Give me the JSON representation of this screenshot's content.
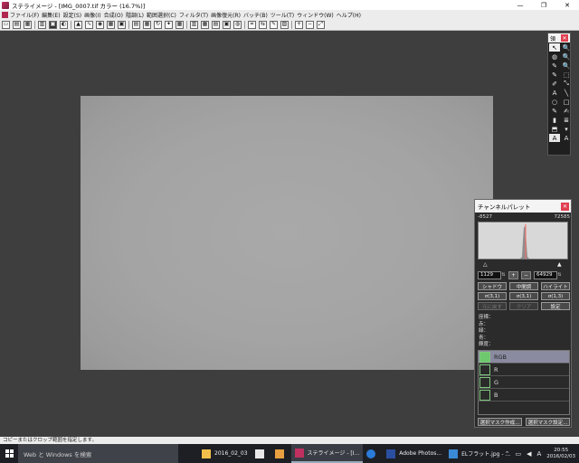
{
  "window": {
    "title": "ステライメージ - [IMG_0007.tif カラー (16.7%)]",
    "controls": [
      "—",
      "❐",
      "✕"
    ]
  },
  "menubar": {
    "items": [
      "ファイル(F)",
      "編集(E)",
      "設定(S)",
      "画像(I)",
      "合成(O)",
      "階調(L)",
      "範囲選択(C)",
      "フィルタ(T)",
      "画像復元(R)",
      "バッチ(B)",
      "ツール(T)",
      "ウィンドウ(W)",
      "ヘルプ(H)"
    ]
  },
  "tool_palette": {
    "title": "領",
    "close": "✕",
    "tools": [
      "↖",
      "🔍",
      "◍",
      "🔍",
      "✎",
      "🔍",
      "✎",
      "⬚",
      "✐",
      "⤡",
      "A",
      "╲",
      "○",
      "□",
      "✎",
      "✍",
      "▮",
      "≣",
      "⬒",
      "▾",
      "A",
      "A"
    ]
  },
  "channel_palette": {
    "title": "チャンネルパレット",
    "close": "✕",
    "range_min": "-8527",
    "range_max": "72585",
    "value_low": "1129",
    "value_high": "64929",
    "buttons": [
      "シャドウ",
      "中間調",
      "ハイライト",
      "σ(3,1)",
      "σ(3,1)",
      "σ(1,3)",
      "元に戻す",
      "クリア",
      "設定"
    ],
    "info_labels": [
      "座標：",
      "赤：",
      "緑：",
      "青：",
      "輝度："
    ],
    "channels": [
      "RGB",
      "R",
      "G",
      "B"
    ],
    "mask_buttons": [
      "選択マスク作成...",
      "選択マスク設定..."
    ]
  },
  "statusbar": {
    "text": "コピーまたはクロップ範囲を指定します。"
  },
  "taskbar": {
    "search_placeholder": "Web と Windows を検索",
    "apps": [
      {
        "label": "2016_02_03",
        "color": "#f2c04a"
      },
      {
        "label": "",
        "color": "#e8e8e8"
      },
      {
        "label": "",
        "color": "#e8a040"
      },
      {
        "label": "ステライメージ - [I...",
        "color": "#c03060"
      },
      {
        "label": "",
        "color": "#2a7ad8"
      },
      {
        "label": "Adobe Photos...",
        "color": "#2a4fa0"
      },
      {
        "label": "ELフラット.jpg - ...",
        "color": "#3a8ad8"
      }
    ],
    "time": "20:55",
    "date": "2016/02/03",
    "ime": "A"
  }
}
